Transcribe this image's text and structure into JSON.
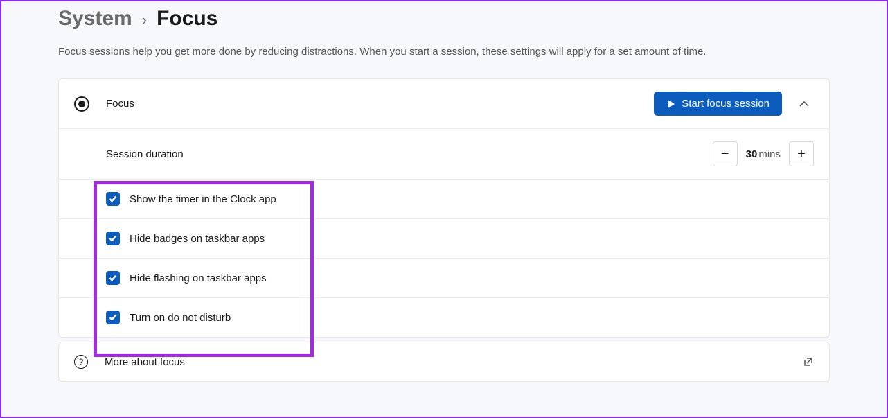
{
  "breadcrumb": {
    "parent": "System",
    "current": "Focus"
  },
  "description": "Focus sessions help you get more done by reducing distractions. When you start a session, these settings will apply for a set amount of time.",
  "header": {
    "label": "Focus",
    "start_button": "Start focus session"
  },
  "duration": {
    "label": "Session duration",
    "value": "30",
    "unit": "mins"
  },
  "options": [
    {
      "label": "Show the timer in the Clock app",
      "checked": true
    },
    {
      "label": "Hide badges on taskbar apps",
      "checked": true
    },
    {
      "label": "Hide flashing on taskbar apps",
      "checked": true
    },
    {
      "label": "Turn on do not disturb",
      "checked": true
    }
  ],
  "more": {
    "label": "More about focus"
  }
}
